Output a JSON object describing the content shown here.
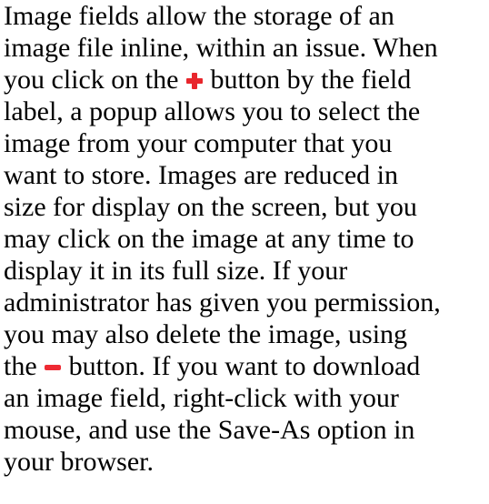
{
  "paragraph": {
    "line1": "Image fields allow the storage of an",
    "line2": "image file inline, within an issue. When",
    "line3_before": "you click on the ",
    "line3_after": " button by the field",
    "line4": "label, a popup allows you to select the",
    "line5": "image from your computer that you",
    "line6": "want to store. Images are reduced in",
    "line7": "size for display on the screen, but you",
    "line8": "may click on the image at any time to",
    "line9": "display it in its full size. If your",
    "line10": "administrator has given you permission,",
    "line11": "you may also delete the image, using",
    "line12_before": "the ",
    "line12_after": " button. If you want to download",
    "line13": "an image field, right-click with your",
    "line14": "mouse, and use the Save-As option in",
    "line15": "your browser."
  },
  "icons": {
    "add": "plus-icon",
    "delete": "minus-icon",
    "color": "#e8262c"
  }
}
